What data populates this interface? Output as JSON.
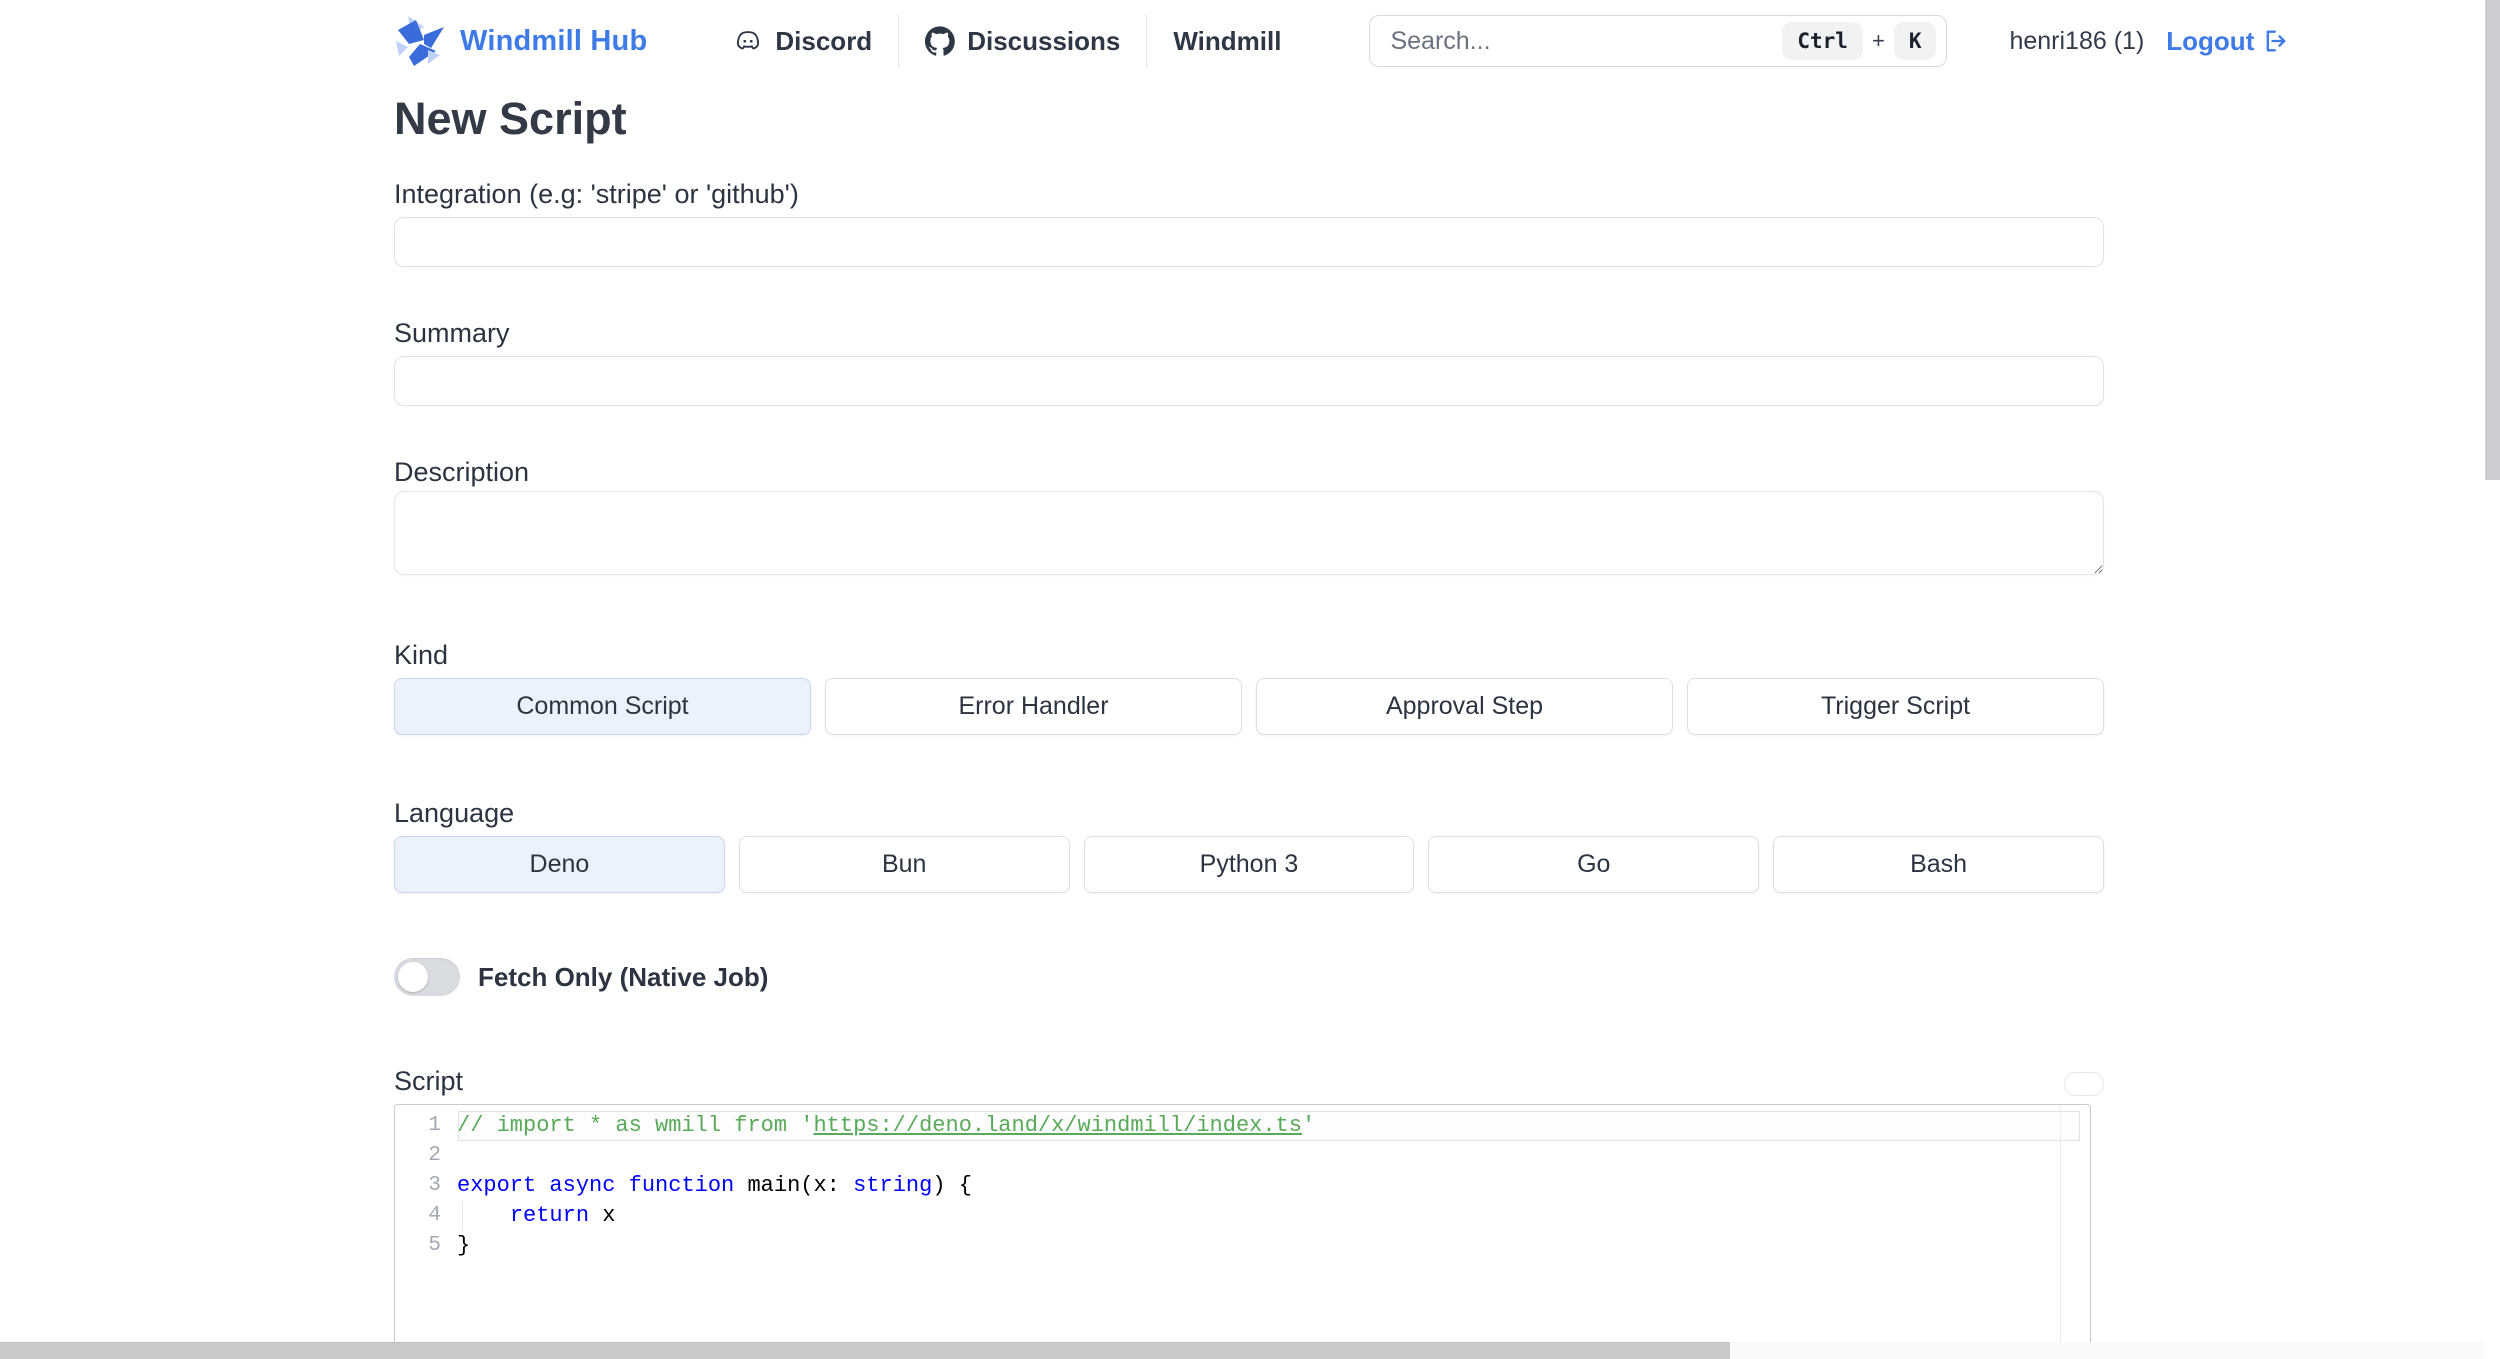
{
  "colors": {
    "accent_blue": "#3E7BE8",
    "selected_bg": "#EBF2FC",
    "selected_border": "#C9D6EC",
    "code_keyword": "#0000FF",
    "code_comment": "#008000",
    "code_plain": "#000000"
  },
  "header": {
    "brand": "Windmill Hub",
    "nav": [
      {
        "label": "Discord",
        "icon": "discord-icon"
      },
      {
        "label": "Discussions",
        "icon": "github-icon"
      },
      {
        "label": "Windmill",
        "icon": ""
      }
    ],
    "search": {
      "placeholder": "Search...",
      "key1": "Ctrl",
      "separator": "+",
      "key2": "K"
    },
    "username": "henri186 (1)",
    "logout_label": "Logout"
  },
  "page": {
    "title": "New Script"
  },
  "form": {
    "integration": {
      "label": "Integration (e.g: 'stripe' or 'github')",
      "value": ""
    },
    "summary": {
      "label": "Summary",
      "value": ""
    },
    "description": {
      "label": "Description",
      "value": ""
    },
    "kind": {
      "label": "Kind",
      "options": [
        "Common Script",
        "Error Handler",
        "Approval Step",
        "Trigger Script"
      ],
      "selected": "Common Script"
    },
    "language": {
      "label": "Language",
      "options": [
        "Deno",
        "Bun",
        "Python 3",
        "Go",
        "Bash"
      ],
      "selected": "Deno"
    },
    "fetch_only": {
      "label": "Fetch Only (Native Job)",
      "enabled": false
    },
    "script": {
      "label": "Script",
      "editor": {
        "lines": [
          {
            "num": "1",
            "current": true,
            "tokens": [
              {
                "t": "comment",
                "s": "// import * as wmill from '"
              },
              {
                "t": "comment-link",
                "s": "https://deno.land/x/windmill/index.ts"
              },
              {
                "t": "comment",
                "s": "'"
              }
            ]
          },
          {
            "num": "2",
            "tokens": []
          },
          {
            "num": "3",
            "tokens": [
              {
                "t": "keyword",
                "s": "export"
              },
              {
                "t": "plain",
                "s": " "
              },
              {
                "t": "keyword",
                "s": "async"
              },
              {
                "t": "plain",
                "s": " "
              },
              {
                "t": "keyword",
                "s": "function"
              },
              {
                "t": "plain",
                "s": " main(x: "
              },
              {
                "t": "keyword",
                "s": "string"
              },
              {
                "t": "plain",
                "s": ") {"
              }
            ]
          },
          {
            "num": "4",
            "guide": true,
            "tokens": [
              {
                "t": "plain",
                "s": "    "
              },
              {
                "t": "keyword",
                "s": "return"
              },
              {
                "t": "plain",
                "s": " x"
              }
            ]
          },
          {
            "num": "5",
            "tokens": [
              {
                "t": "plain",
                "s": "}"
              }
            ]
          }
        ]
      }
    }
  }
}
